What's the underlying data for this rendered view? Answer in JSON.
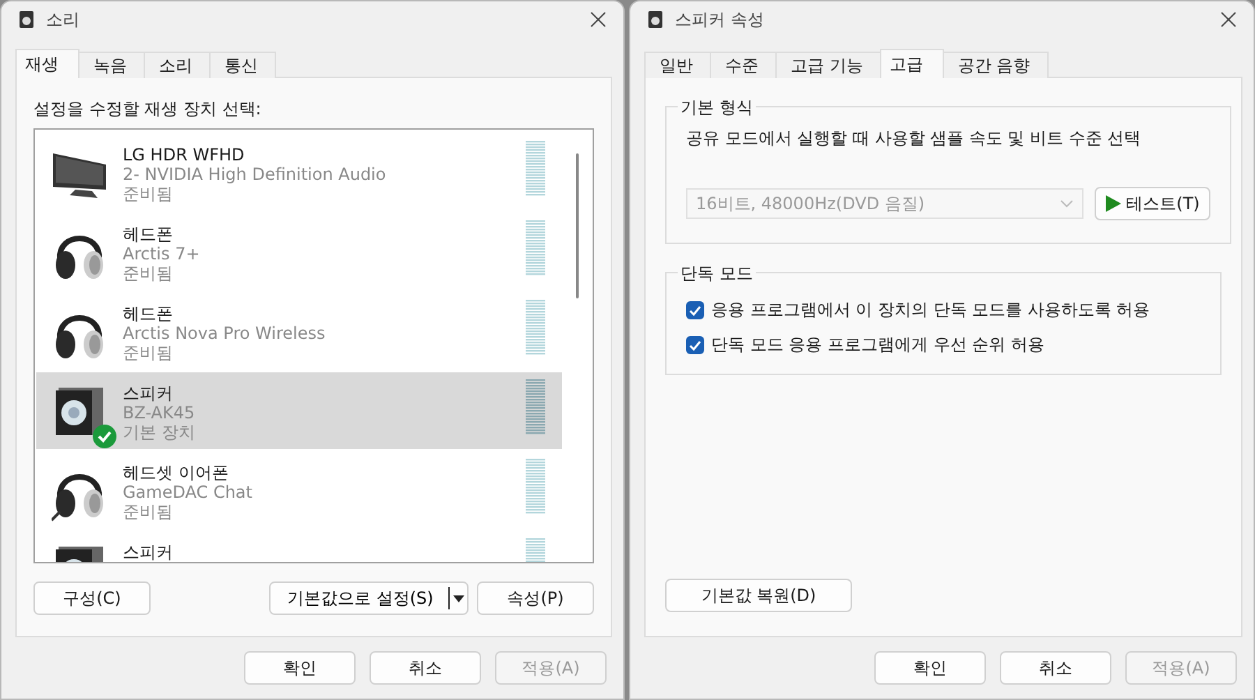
{
  "sound_window": {
    "title": "소리",
    "tabs": [
      {
        "label": "재생",
        "selected": true
      },
      {
        "label": "녹음",
        "selected": false
      },
      {
        "label": "소리",
        "selected": false
      },
      {
        "label": "통신",
        "selected": false
      }
    ],
    "prompt": "설정을 수정할 재생 장치 선택:",
    "devices": [
      {
        "kind": "monitor",
        "name": "LG HDR WFHD",
        "detail": "2- NVIDIA High Definition Audio",
        "status": "준비됨",
        "selected": false,
        "default": false
      },
      {
        "kind": "headphones",
        "name": "헤드폰",
        "detail": "Arctis 7+",
        "status": "준비됨",
        "selected": false,
        "default": false
      },
      {
        "kind": "headphones",
        "name": "헤드폰",
        "detail": "Arctis Nova Pro Wireless",
        "status": "준비됨",
        "selected": false,
        "default": false
      },
      {
        "kind": "speaker",
        "name": "스피커",
        "detail": "BZ-AK45",
        "status": "기본 장치",
        "selected": true,
        "default": true
      },
      {
        "kind": "headset",
        "name": "헤드셋 이어폰",
        "detail": "GameDAC Chat",
        "status": "준비됨",
        "selected": false,
        "default": false
      },
      {
        "kind": "speaker",
        "name": "스피커",
        "selected": false,
        "default": false
      }
    ],
    "configure_button": "구성(C)",
    "set_default_button": "기본값으로 설정(S)",
    "properties_button": "속성(P)",
    "footer": [
      {
        "label": "확인",
        "disabled": false
      },
      {
        "label": "취소",
        "disabled": false
      },
      {
        "label": "적용(A)",
        "disabled": true
      }
    ]
  },
  "speaker_properties": {
    "title": "스피커 속성",
    "tabs": [
      {
        "label": "일반",
        "selected": false
      },
      {
        "label": "수준",
        "selected": false
      },
      {
        "label": "고급 기능",
        "selected": false
      },
      {
        "label": "고급",
        "selected": true
      },
      {
        "label": "공간 음향",
        "selected": false
      }
    ],
    "default_format": {
      "legend": "기본 형식",
      "description": "공유 모드에서 실행할 때 사용할 샘플 속도 및 비트 수준 선택",
      "format": {
        "value": "16비트, 48000Hz(DVD 음질)",
        "disabled": true
      },
      "test_button": "테스트(T)"
    },
    "exclusive_mode": {
      "legend": "단독 모드",
      "options": [
        {
          "label": "응용 프로그램에서 이 장치의 단독 모드를 사용하도록 허용",
          "checked": true
        },
        {
          "label": "단독 모드 응용 프로그램에게 우선 순위 허용",
          "checked": true
        }
      ]
    },
    "restore_button": "기본값 복원(D)",
    "footer": [
      {
        "label": "확인",
        "disabled": false
      },
      {
        "label": "취소",
        "disabled": false
      },
      {
        "label": "적용(A)",
        "disabled": true
      }
    ]
  }
}
